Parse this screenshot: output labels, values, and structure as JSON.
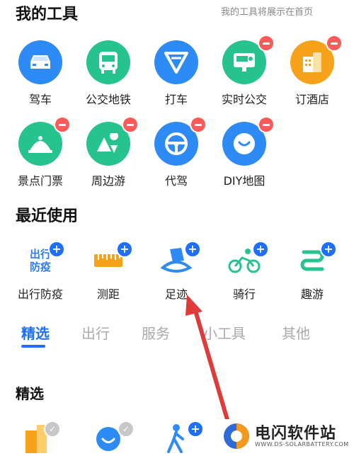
{
  "my_tools": {
    "title": "我的工具",
    "note": "我的工具将展示在首页",
    "items": [
      {
        "label": "驾车",
        "icon": "car-icon",
        "color": "#2e8bf5"
      },
      {
        "label": "公交地铁",
        "icon": "bus-icon",
        "color": "#26c38f"
      },
      {
        "label": "打车",
        "icon": "taxi-icon",
        "color": "#2e8bf5"
      },
      {
        "label": "实时公交",
        "icon": "realtime-bus-icon",
        "color": "#26c38f"
      },
      {
        "label": "订酒店",
        "icon": "hotel-icon",
        "color": "#f7a21b"
      },
      {
        "label": "景点门票",
        "icon": "scenic-ticket-icon",
        "color": "#26c38f"
      },
      {
        "label": "周边游",
        "icon": "nearby-trip-icon",
        "color": "#26c38f"
      },
      {
        "label": "代驾",
        "icon": "steering-wheel-icon",
        "color": "#2e8bf5"
      },
      {
        "label": "DIY地图",
        "icon": "diy-map-icon",
        "color": "#2e8bf5"
      }
    ]
  },
  "recent": {
    "title": "最近使用",
    "items": [
      {
        "label": "出行防疫",
        "icon": "travel-epidemic-icon",
        "icon_text_1": "出行",
        "icon_text_2": "防疫"
      },
      {
        "label": "测距",
        "icon": "ruler-icon"
      },
      {
        "label": "足迹",
        "icon": "footprint-icon"
      },
      {
        "label": "骑行",
        "icon": "cycling-icon"
      },
      {
        "label": "趣游",
        "icon": "fun-trip-icon"
      }
    ]
  },
  "tabs": [
    "精选",
    "出行",
    "服务",
    "小工具",
    "其他"
  ],
  "featured": {
    "title": "精选"
  },
  "watermark": {
    "name": "电闪软件站",
    "url": "WWW.DS-SOLARBATTERY.COM"
  }
}
